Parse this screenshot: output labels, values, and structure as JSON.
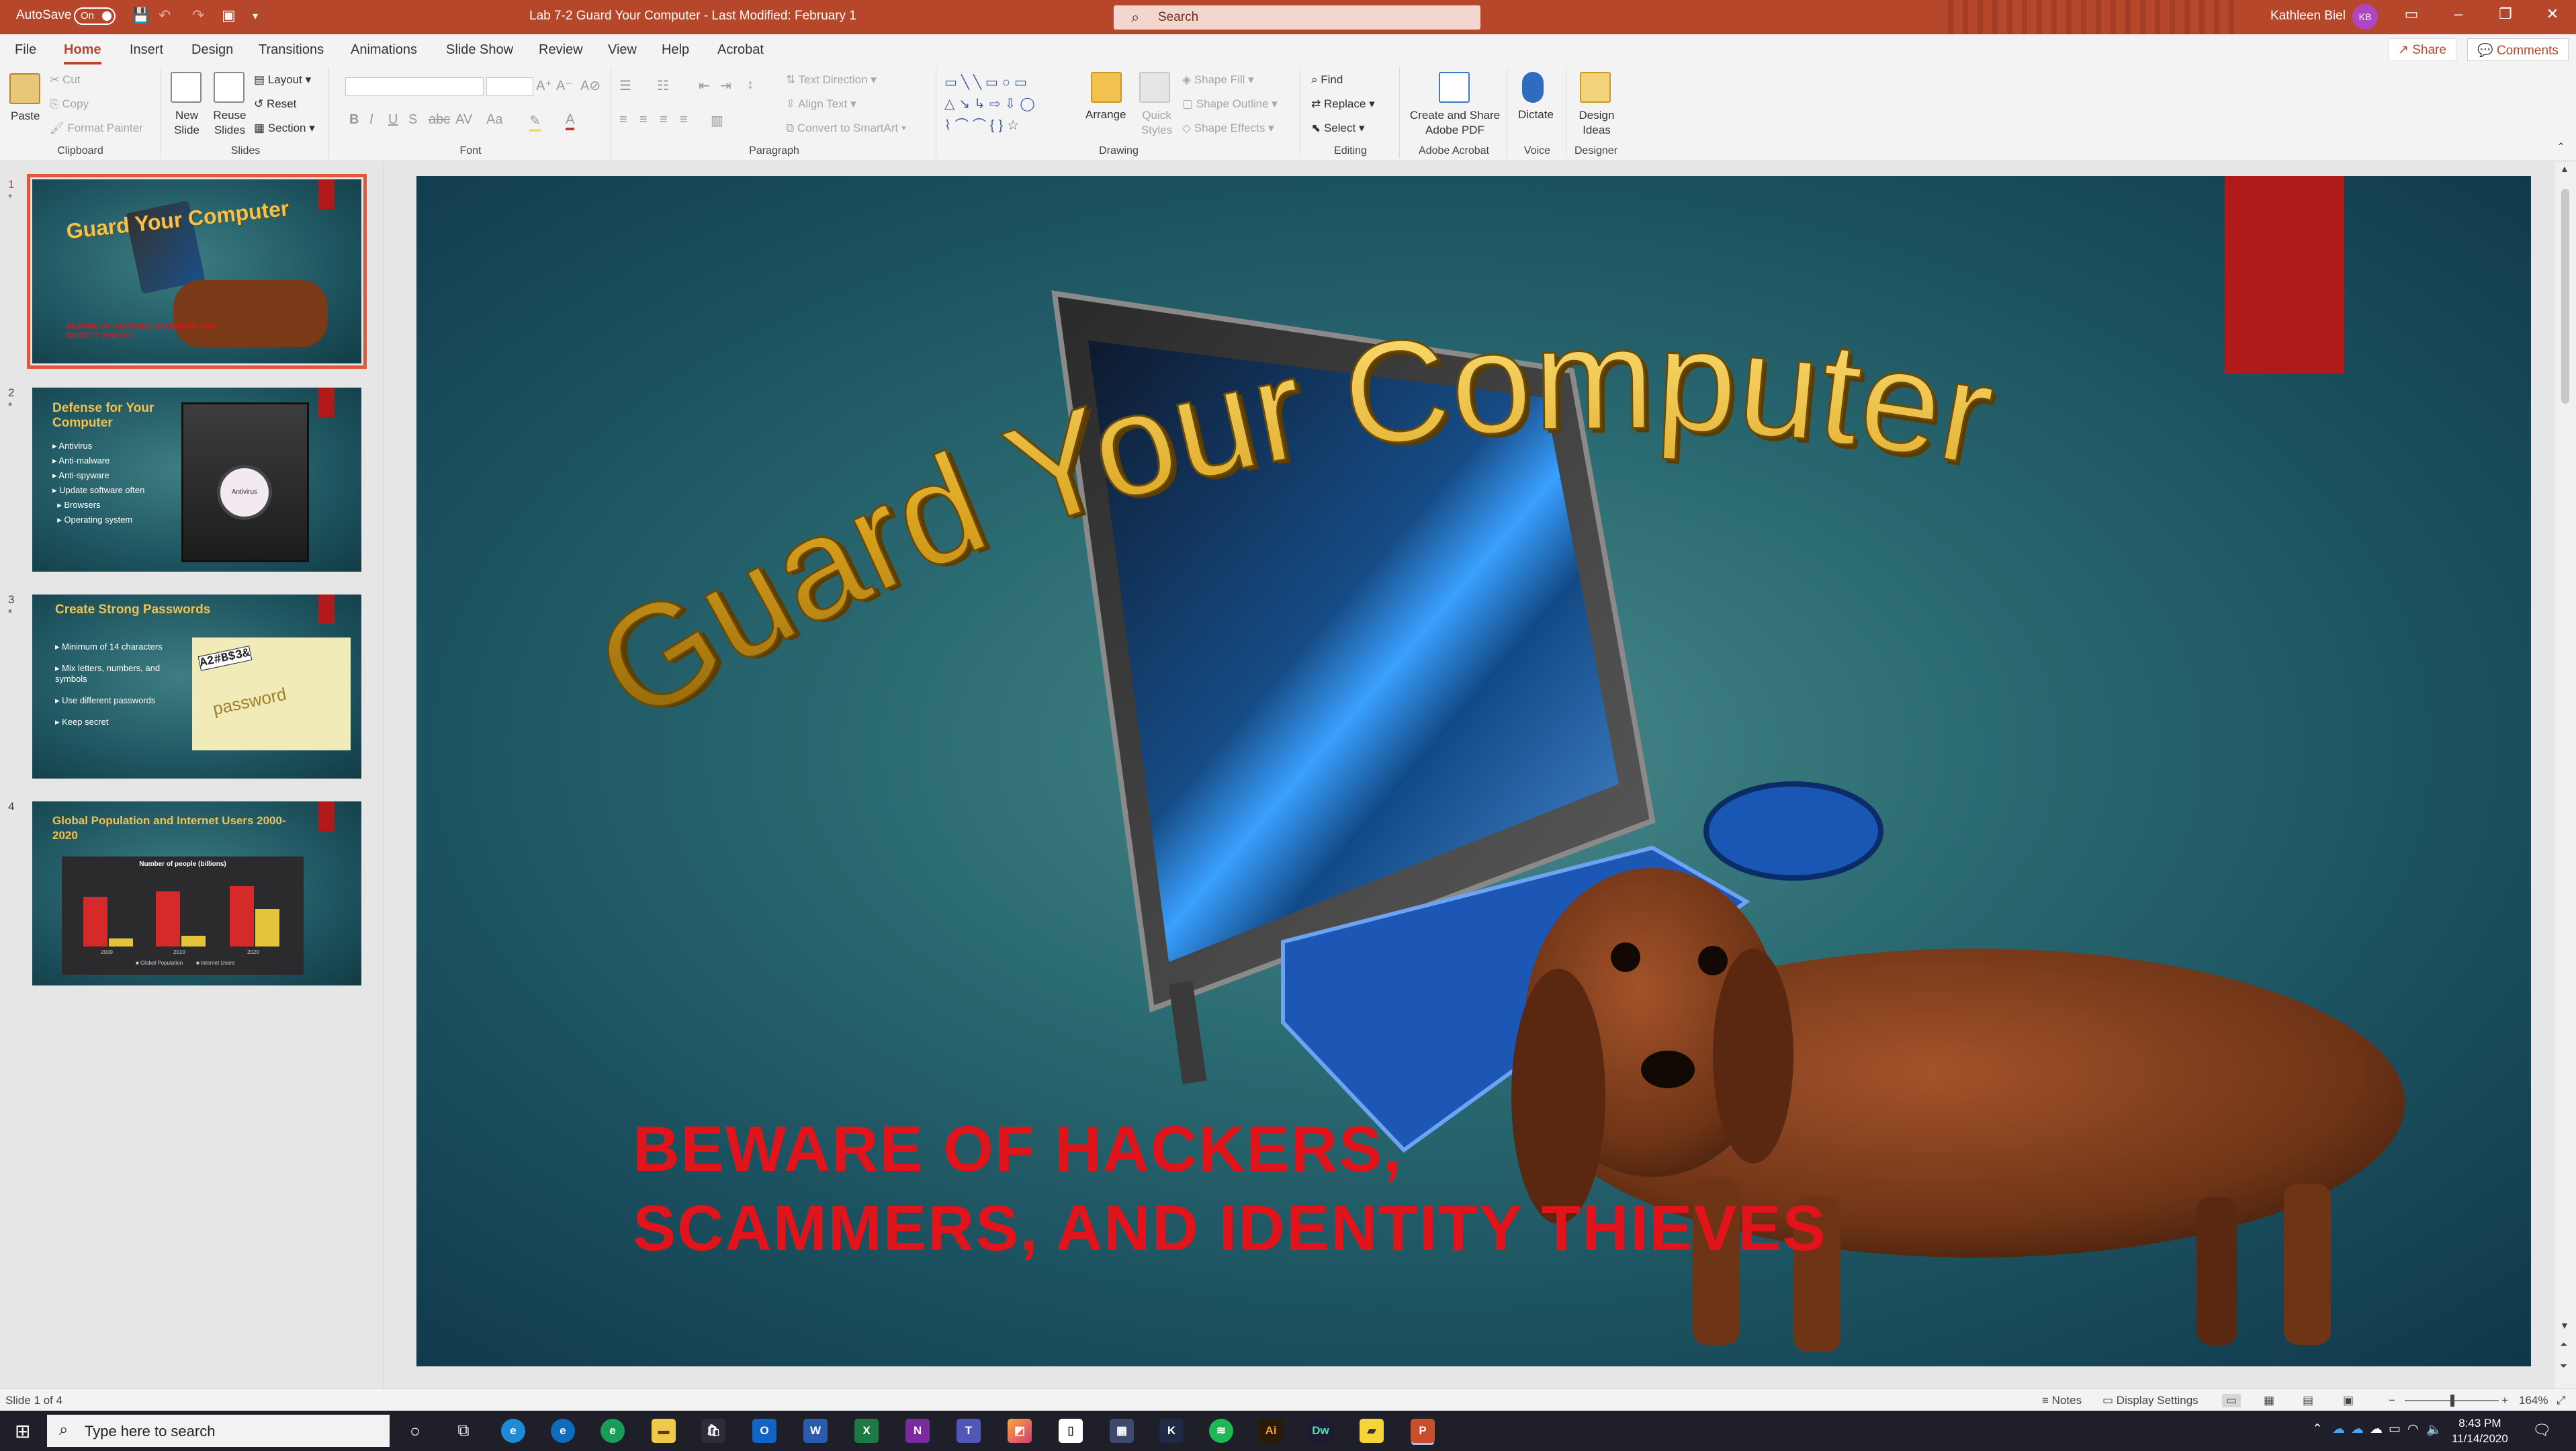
{
  "titlebar": {
    "autosave_label": "AutoSave",
    "autosave_state": "On",
    "doc_title": "Lab 7-2 Guard Your Computer  -  Last Modified: February 1",
    "search_placeholder": "Search",
    "user_name": "Kathleen Biel",
    "user_initials": "KB",
    "accent": "#b7472a"
  },
  "tabs": [
    "File",
    "Home",
    "Insert",
    "Design",
    "Transitions",
    "Animations",
    "Slide Show",
    "Review",
    "View",
    "Help",
    "Acrobat"
  ],
  "active_tab": "Home",
  "share_label": "Share",
  "comments_label": "Comments",
  "ribbon": {
    "clipboard": {
      "label": "Clipboard",
      "paste": "Paste",
      "cut": "Cut",
      "copy": "Copy",
      "format_painter": "Format Painter"
    },
    "slides": {
      "label": "Slides",
      "new_slide": "New Slide",
      "reuse_slides": "Reuse Slides",
      "layout": "Layout",
      "reset": "Reset",
      "section": "Section"
    },
    "font": {
      "label": "Font"
    },
    "paragraph": {
      "label": "Paragraph",
      "text_direction": "Text Direction",
      "align_text": "Align Text",
      "convert_smartart": "Convert to SmartArt"
    },
    "drawing": {
      "label": "Drawing",
      "arrange": "Arrange",
      "quick_styles": "Quick Styles",
      "shape_fill": "Shape Fill",
      "shape_outline": "Shape Outline",
      "shape_effects": "Shape Effects"
    },
    "editing": {
      "label": "Editing",
      "find": "Find",
      "replace": "Replace",
      "select": "Select"
    },
    "acrobat": {
      "label": "Adobe Acrobat",
      "create_share": "Create and Share Adobe PDF"
    },
    "voice": {
      "label": "Voice",
      "dictate": "Dictate"
    },
    "designer": {
      "label": "Designer",
      "design_ideas": "Design Ideas"
    }
  },
  "thumbnails": [
    {
      "num": "1",
      "title": "Guard Your Computer",
      "subtitle": "BEWARE OF HACKERS, SCAMMERS, AND IDENTITY THIEVES"
    },
    {
      "num": "2",
      "title": "Defense for Your Computer",
      "bullets": [
        "Antivirus",
        "Anti-malware",
        "Anti-spyware",
        "Update software often",
        "Browsers",
        "Operating system"
      ],
      "pic_label": "Antivirus"
    },
    {
      "num": "3",
      "title": "Create Strong Passwords",
      "bullets": [
        "Minimum of 14 characters",
        "Mix letters, numbers, and symbols",
        "Use different passwords",
        "Keep secret"
      ],
      "pic_label": "password",
      "pic_text": "A2#B$3&"
    },
    {
      "num": "4",
      "title": "Global Population and Internet Users 2000-2020",
      "chart_title": "Number of people (billions)",
      "chart_categories": [
        "2000",
        "2010",
        "2020"
      ],
      "chart_legend": [
        "Global Population",
        "Internet Users"
      ]
    }
  ],
  "slide": {
    "title": "Guard Your Computer",
    "subtitle": "BEWARE OF HACKERS,\nSCAMMERS, AND IDENTITY THIEVES",
    "title_color": "#d9a21d",
    "subtitle_color": "#e0141a"
  },
  "statusbar": {
    "slide_info": "Slide 1 of 4",
    "notes": "Notes",
    "display_settings": "Display Settings",
    "zoom": "164%"
  },
  "taskbar": {
    "search_placeholder": "Type here to search",
    "time": "8:43 PM",
    "date": "11/14/2020"
  }
}
